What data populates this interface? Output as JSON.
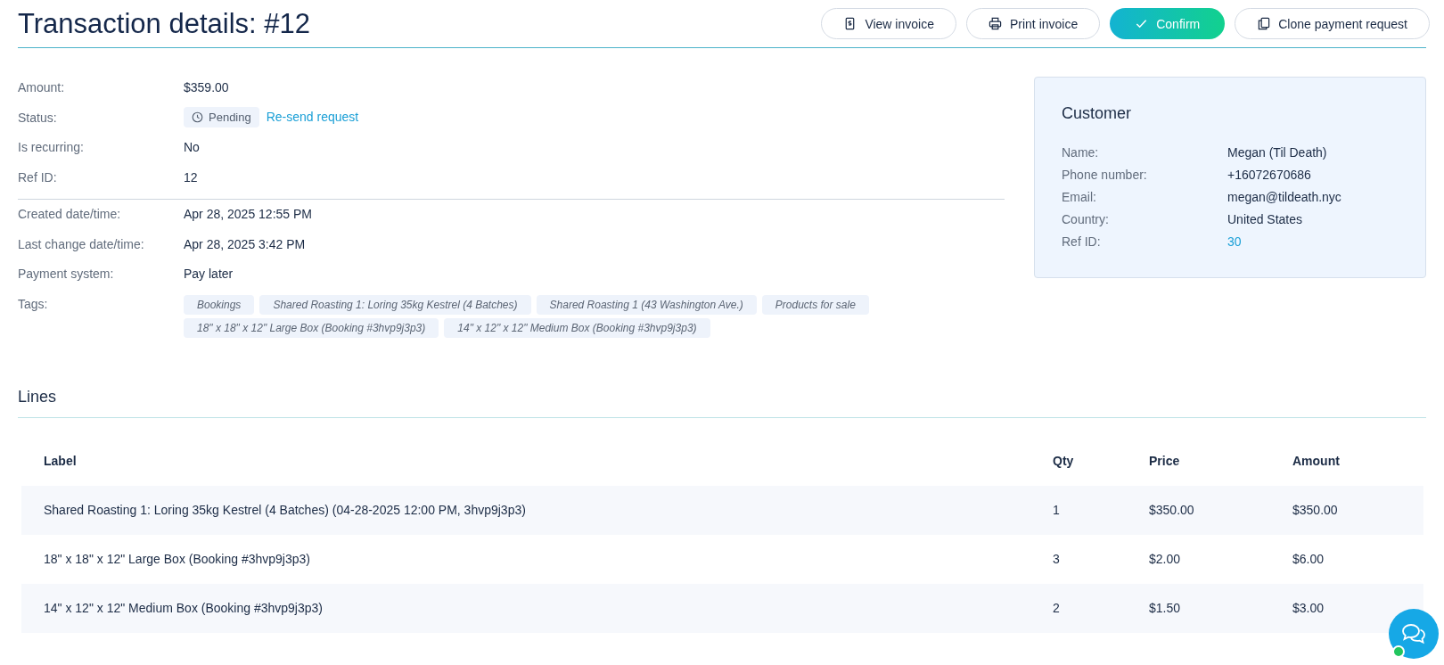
{
  "title": "Transaction details: #12",
  "actions": [
    {
      "label": "View invoice",
      "kind": "invoice"
    },
    {
      "label": "Print invoice",
      "kind": "print"
    },
    {
      "label": "Confirm",
      "kind": "confirm"
    },
    {
      "label": "Clone payment request",
      "kind": "clone"
    }
  ],
  "details": [
    {
      "kind": "text",
      "label": "Amount:",
      "value": "$359.00"
    },
    {
      "kind": "status",
      "label": "Status:",
      "badge": "Pending",
      "link": "Re-send request"
    },
    {
      "kind": "text",
      "label": "Is recurring:",
      "value": "No"
    },
    {
      "kind": "text",
      "label": "Ref ID:",
      "value": "12"
    },
    {
      "kind": "divider"
    },
    {
      "kind": "text",
      "label": "Created date/time:",
      "value": "Apr 28, 2025 12:55 PM"
    },
    {
      "kind": "text",
      "label": "Last change date/time:",
      "value": "Apr 28, 2025 3:42 PM"
    },
    {
      "kind": "text",
      "label": "Payment system:",
      "value": "Pay later"
    },
    {
      "kind": "tags",
      "label": "Tags:",
      "tags": [
        "Bookings",
        "Shared Roasting 1: Loring 35kg Kestrel (4 Batches)",
        "Shared Roasting 1 (43 Washington Ave.)",
        "Products for sale",
        "18\" x 18\" x 12\" Large Box (Booking #3hvp9j3p3)",
        "14\" x 12\" x 12\" Medium Box (Booking #3hvp9j3p3)"
      ]
    }
  ],
  "customer": {
    "title": "Customer",
    "fields": [
      {
        "label": "Name:",
        "value": "Megan (Til Death)",
        "kind": "text"
      },
      {
        "label": "Phone number:",
        "value": "+16072670686",
        "kind": "text"
      },
      {
        "label": "Email:",
        "value": "megan@tildeath.nyc",
        "kind": "text"
      },
      {
        "label": "Country:",
        "value": "United States",
        "kind": "text"
      },
      {
        "label": "Ref ID:",
        "value": "30",
        "kind": "link"
      }
    ]
  },
  "lines": {
    "title": "Lines",
    "columns": [
      "Label",
      "Qty",
      "Price",
      "Amount"
    ],
    "rows": [
      [
        "Shared Roasting 1: Loring 35kg Kestrel (4 Batches) (04-28-2025 12:00 PM, 3hvp9j3p3)",
        "1",
        "$350.00",
        "$350.00"
      ],
      [
        "18\" x 18\" x 12\" Large Box (Booking #3hvp9j3p3)",
        "3",
        "$2.00",
        "$6.00"
      ],
      [
        "14\" x 12\" x 12\" Medium Box (Booking #3hvp9j3p3)",
        "2",
        "$1.50",
        "$3.00"
      ]
    ]
  },
  "chat": {
    "online": true
  }
}
